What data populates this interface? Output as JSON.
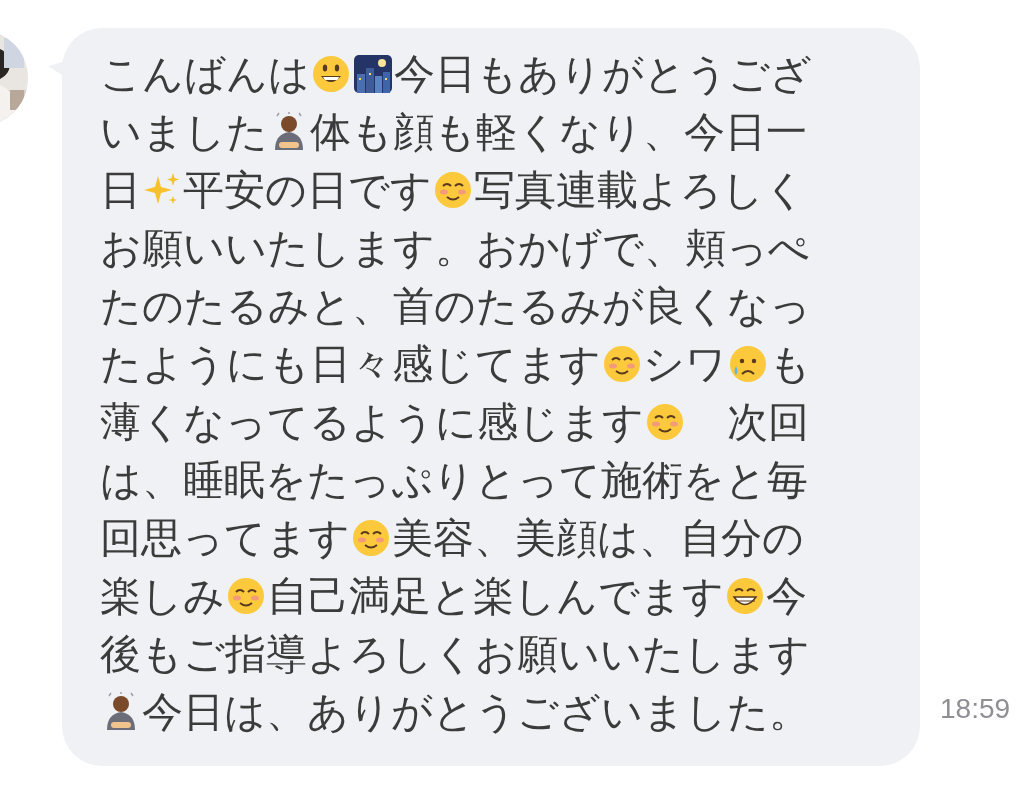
{
  "message": {
    "lines": [
      [
        {
          "kind": "text",
          "text": "こんばんは"
        },
        {
          "kind": "grin"
        },
        {
          "kind": "night"
        },
        {
          "kind": "text",
          "text": "今日もありがとうござ"
        }
      ],
      [
        {
          "kind": "text",
          "text": "いました"
        },
        {
          "kind": "bow"
        },
        {
          "kind": "text",
          "text": "体も顔も軽くなり、今日一"
        }
      ],
      [
        {
          "kind": "text",
          "text": "日"
        },
        {
          "kind": "sparkles"
        },
        {
          "kind": "text",
          "text": "平安の日です"
        },
        {
          "kind": "blush"
        },
        {
          "kind": "text",
          "text": "写真連載よろしく"
        }
      ],
      [
        {
          "kind": "text",
          "text": "お願いいたします。おかげで、頬っぺ"
        }
      ],
      [
        {
          "kind": "text",
          "text": "たのたるみと、首のたるみが良くなっ"
        }
      ],
      [
        {
          "kind": "text",
          "text": "たようにも日々感じてます"
        },
        {
          "kind": "blush"
        },
        {
          "kind": "text",
          "text": "シワ"
        },
        {
          "kind": "cry"
        },
        {
          "kind": "text",
          "text": "も"
        }
      ],
      [
        {
          "kind": "text",
          "text": "薄くなってるように感じます"
        },
        {
          "kind": "blush"
        },
        {
          "kind": "text",
          "text": "　次回"
        }
      ],
      [
        {
          "kind": "text",
          "text": "は、睡眠をたっぷりとって施術をと毎"
        }
      ],
      [
        {
          "kind": "text",
          "text": "回思ってます"
        },
        {
          "kind": "blush"
        },
        {
          "kind": "text",
          "text": "美容、美顔は、自分の"
        }
      ],
      [
        {
          "kind": "text",
          "text": "楽しみ"
        },
        {
          "kind": "blush"
        },
        {
          "kind": "text",
          "text": "自己満足と楽しんでます"
        },
        {
          "kind": "beam"
        },
        {
          "kind": "text",
          "text": "今"
        }
      ],
      [
        {
          "kind": "text",
          "text": "後もご指導よろしくお願いいたします"
        }
      ],
      [
        {
          "kind": "bow"
        },
        {
          "kind": "text",
          "text": "今日は、ありがとうございました。"
        }
      ]
    ],
    "time": "18:59"
  }
}
